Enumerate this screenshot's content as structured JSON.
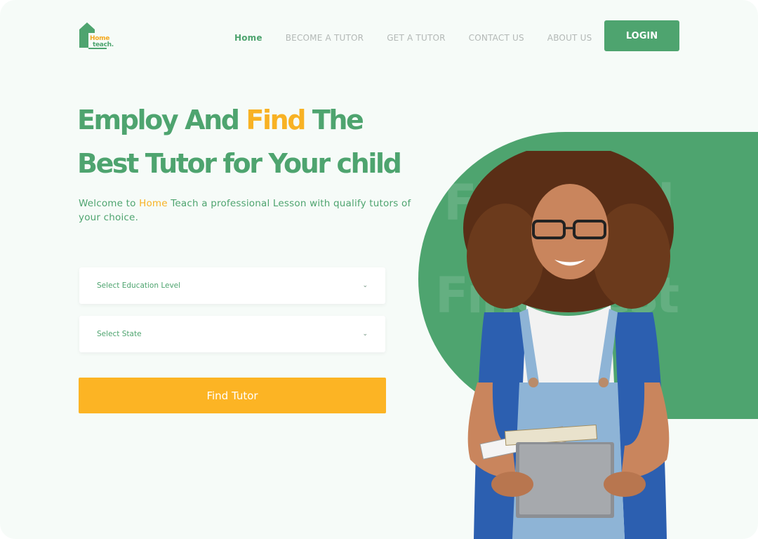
{
  "brand": {
    "logo_home": "Home",
    "logo_teach": "teach."
  },
  "nav": {
    "items": [
      {
        "label": "Home",
        "active": true
      },
      {
        "label": "BECOME A TUTOR",
        "active": false
      },
      {
        "label": "GET A TUTOR",
        "active": false
      },
      {
        "label": "CONTACT US",
        "active": false
      },
      {
        "label": "ABOUT US",
        "active": false
      }
    ],
    "login_label": "LOGIN"
  },
  "hero": {
    "title_line1_part1": "Employ And ",
    "title_line1_highlight": "Find",
    "title_line1_part2": " The",
    "title_line2": "Best Tutor for Your child",
    "subtitle_part1": "Welcome to ",
    "subtitle_highlight": "Home",
    "subtitle_part2": " Teach a professional Lesson with qualify tutors of your choice.",
    "ghost_line1": "Find And",
    "ghost_line2": "Find Best"
  },
  "form": {
    "education_level": {
      "placeholder": "Select Education Level"
    },
    "state": {
      "placeholder": "Select State"
    },
    "submit_label": "Find Tutor"
  },
  "colors": {
    "primary_green": "#4ea46f",
    "accent_yellow": "#fcb424",
    "background": "#f6fbf8"
  },
  "icons": {
    "dropdown": "chevron-down-icon",
    "logo": "house-icon"
  }
}
